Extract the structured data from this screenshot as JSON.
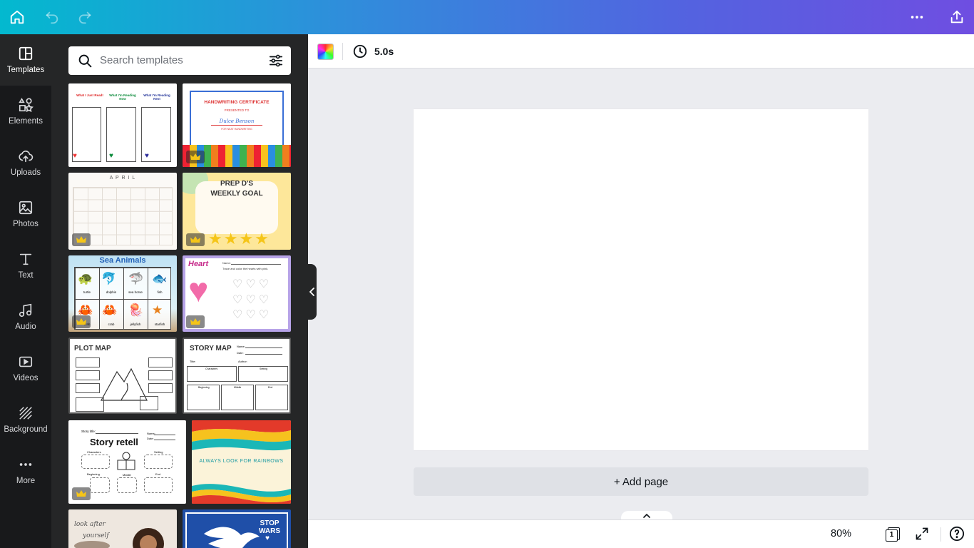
{
  "topbar": {
    "home_icon": "home-icon",
    "undo_icon": "undo-icon",
    "redo_icon": "redo-icon",
    "more_icon": "more-horizontal-icon",
    "share_icon": "share-upload-icon"
  },
  "rail": {
    "items": [
      {
        "label": "Templates",
        "icon": "templates-icon"
      },
      {
        "label": "Elements",
        "icon": "elements-shapes-icon"
      },
      {
        "label": "Uploads",
        "icon": "upload-cloud-icon"
      },
      {
        "label": "Photos",
        "icon": "photo-icon"
      },
      {
        "label": "Text",
        "icon": "text-t-icon"
      },
      {
        "label": "Audio",
        "icon": "music-note-icon"
      },
      {
        "label": "Videos",
        "icon": "video-play-icon"
      },
      {
        "label": "Background",
        "icon": "background-pattern-icon"
      },
      {
        "label": "More",
        "icon": "more-dots-icon"
      }
    ]
  },
  "panel": {
    "search_placeholder": "Search templates",
    "thumbnails": {
      "t1": {
        "col1": "What I Just Read!",
        "col2": "What I'm Reading Now",
        "col3": "What I'm Reading Next"
      },
      "t2": {
        "title": "HANDWRITING CERTIFICATE",
        "sub": "PRESENTED TO",
        "name": "Dulce Benson",
        "for": "FOR NEAT HANDWRITING"
      },
      "t3": {
        "title": "A P R I L"
      },
      "t4": {
        "line1": "PREP D'S",
        "line2": "WEEKLY GOAL"
      },
      "t5": {
        "title": "Sea Animals",
        "labels": [
          "turtle",
          "dolphin",
          "sea horse",
          "fish",
          "crab",
          "crab",
          "jellyfish",
          "starfish"
        ]
      },
      "t6": {
        "title": "Heart",
        "name": "Name:",
        "instruction": "Trace and color the hearts with pink."
      },
      "t7": {
        "title": "PLOT MAP"
      },
      "t8": {
        "title": "STORY MAP",
        "f1": "Name:",
        "f2": "Date:",
        "f3": "Title:",
        "f4": "Author:",
        "c1": "Characters",
        "c2": "Setting",
        "c3": "Beginning",
        "c4": "Middle",
        "c5": "End"
      },
      "t9": {
        "story_title": "Story title:",
        "name": "Name:",
        "date": "Date:",
        "title": "Story retell",
        "c1": "Characters",
        "c2": "Setting",
        "c3": "Beginning",
        "c4": "Middle",
        "c5": "End"
      },
      "t10": {
        "text": "ALWAYS LOOK FOR RAINBOWS"
      },
      "t11": {
        "line1": "look after",
        "line2": "yourself"
      },
      "t12": {
        "line1": "STOP",
        "line2": "WARS"
      }
    }
  },
  "toolbar": {
    "color_icon": "color-picker-icon",
    "timer_icon": "clock-icon",
    "duration": "5.0s"
  },
  "canvas": {
    "add_page_label": "+ Add page"
  },
  "bottombar": {
    "zoom": "80%",
    "page_count": "1",
    "fullscreen_icon": "expand-icon",
    "help_icon": "help-question-icon"
  },
  "colors": {
    "topbar_gradient_start": "#03b9cf",
    "topbar_gradient_end": "#6f4ee1",
    "rail_bg": "#18191b",
    "panel_bg": "#252627",
    "workspace_bg": "#ebecf0"
  }
}
